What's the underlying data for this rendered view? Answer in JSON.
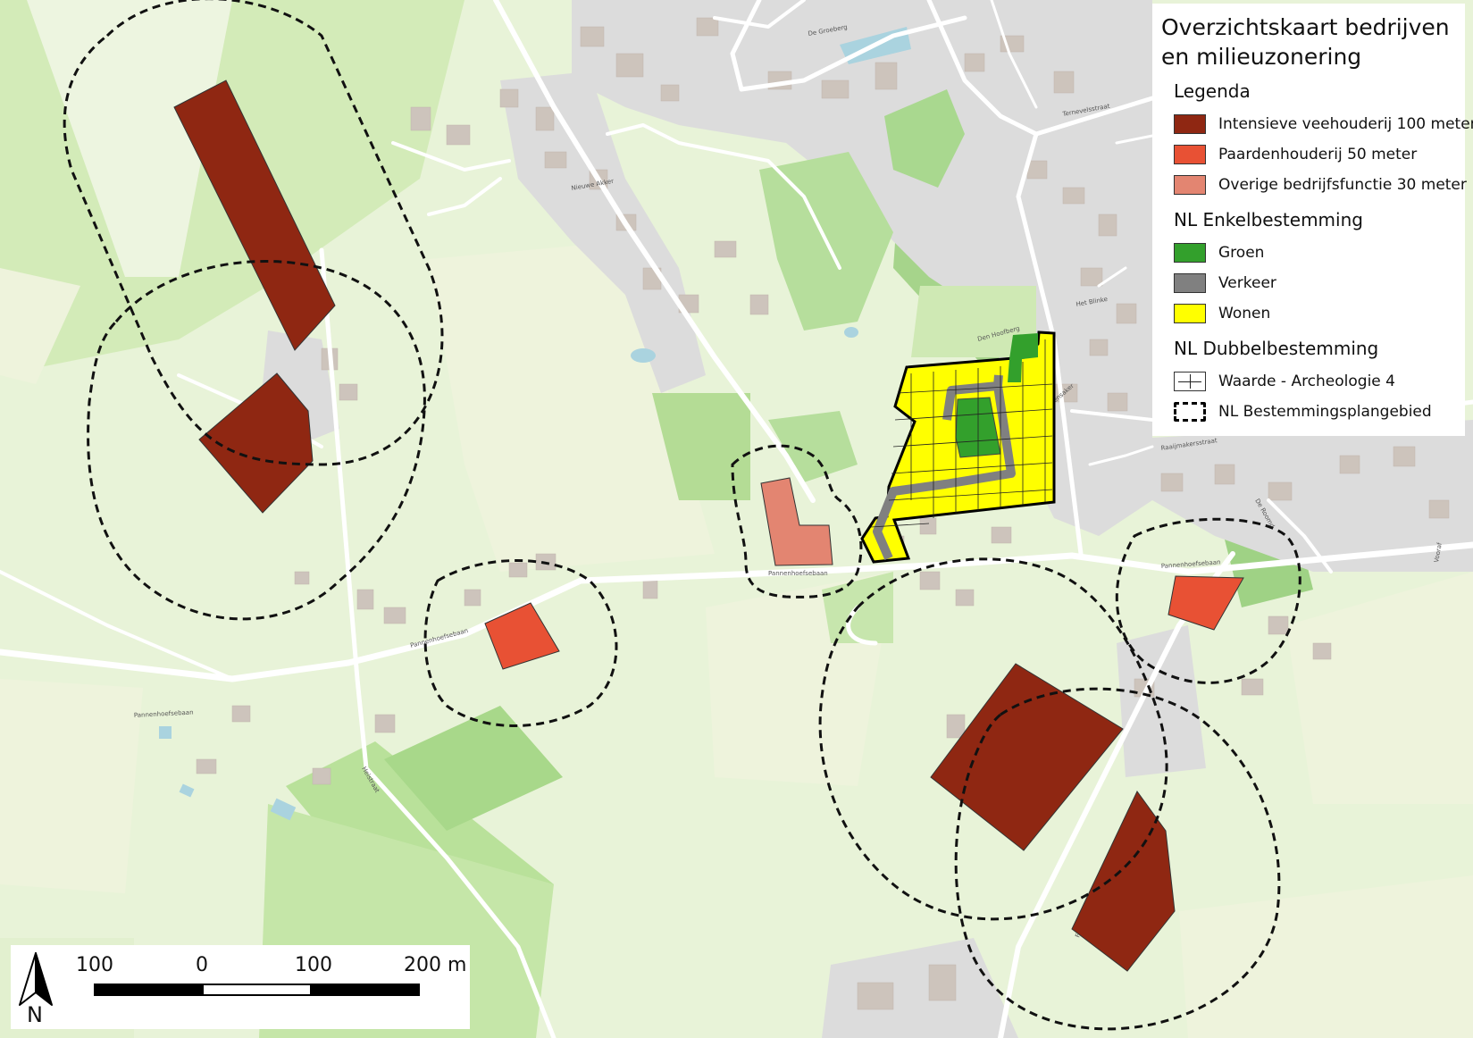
{
  "legend": {
    "title_line1": "Overzichtskaart bedrijven",
    "title_line2": "en milieuzonering",
    "legenda_heading": "Legenda",
    "items_bedrijven": [
      {
        "label": "Intensieve veehouderij 100 meter",
        "color": "#8f2712"
      },
      {
        "label": "Paardenhouderij 50 meter",
        "color": "#e85134"
      },
      {
        "label": "Overige bedrijfsfunctie 30 meter",
        "color": "#e38571"
      }
    ],
    "enkel_heading": "NL Enkelbestemming",
    "items_enkel": [
      {
        "label": "Groen",
        "color": "#33a02c"
      },
      {
        "label": "Verkeer",
        "color": "#808080"
      },
      {
        "label": "Wonen",
        "color": "#ffff00"
      }
    ],
    "dubbel_heading": "NL Dubbelbestemming",
    "item_archeologie": "Waarde - Archeologie 4",
    "item_plangebied": "NL Bestemmingsplangebied"
  },
  "scalebar": {
    "label_left": "100",
    "label_zero": "0",
    "label_mid": "100",
    "label_right": "200 m"
  },
  "north_label": "N",
  "streets": {
    "pannenhoefsebaan": "Pannenhoefsebaan",
    "heistraat": "Heistraat",
    "nieuwe_akker": "Nieuwe Akker",
    "de_groeberg": "De Groeberg",
    "den_hoofberg": "Den Hoofberg",
    "raaijmakersstraat": "Raaijmakersstraat",
    "vinkensaker": "Vinkensaker",
    "het_blinke": "Het Blinke",
    "de_roomd": "De Roomd",
    "ternevelsstraat": "Ternevelsstraat",
    "vooraf": "Vooraf",
    "fort_laan": "Fort Laan"
  },
  "colors": {
    "map_background": "#e8f3d8",
    "field_green": "#d6ecbd",
    "meadow_green": "#c6e5a9",
    "park_green": "#a9d88f",
    "built_area": "#dcdcdc",
    "building": "#cdc4bc",
    "road": "#ffffff",
    "water": "#aad3df",
    "veehouderij": "#8f2712",
    "paardenhouderij": "#e85134",
    "overige": "#e38571",
    "groen": "#33a02c",
    "verkeer": "#808080",
    "wonen": "#ffff00"
  }
}
